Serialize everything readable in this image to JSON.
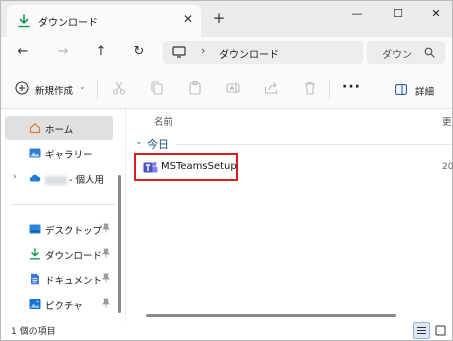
{
  "window": {
    "tab_title": "ダウンロード",
    "new_tab": "+",
    "controls": {
      "minimize": "—",
      "maximize": "☐",
      "close": "✕"
    }
  },
  "navigation": {
    "back": "←",
    "forward": "→",
    "up": "↑",
    "refresh": "↻",
    "breadcrumb_separator": "›",
    "breadcrumb": "ダウンロード",
    "search_placeholder": "ダウン"
  },
  "toolbar": {
    "new_label": "新規作成",
    "new_chevron": "⌄",
    "more": "···",
    "details_label": "詳細"
  },
  "sidebar": {
    "expand": "›",
    "items": [
      {
        "label": "ホーム",
        "icon": "home-icon",
        "selected": true
      },
      {
        "label": "ギャラリー",
        "icon": "gallery-icon"
      },
      {
        "label": "- 個人用",
        "icon": "onedrive-icon"
      },
      {
        "label": "デスクトップ",
        "icon": "desktop-icon",
        "pinned": true
      },
      {
        "label": "ダウンロード",
        "icon": "download-icon",
        "pinned": true
      },
      {
        "label": "ドキュメント",
        "icon": "document-icon",
        "pinned": true
      },
      {
        "label": "ピクチャ",
        "icon": "pictures-icon",
        "pinned": true
      }
    ]
  },
  "file_list": {
    "columns": {
      "name": "名前",
      "date": "更"
    },
    "group": {
      "chevron": "⌄",
      "label": "今日"
    },
    "files": [
      {
        "name": "MSTeamsSetup",
        "icon": "teams-icon",
        "date_partial": "20"
      }
    ]
  },
  "status": {
    "text": "1 個の項目"
  },
  "colors": {
    "accent": "#0067c0",
    "highlight_border": "#d81b1b",
    "teams": "#4b53bc"
  }
}
